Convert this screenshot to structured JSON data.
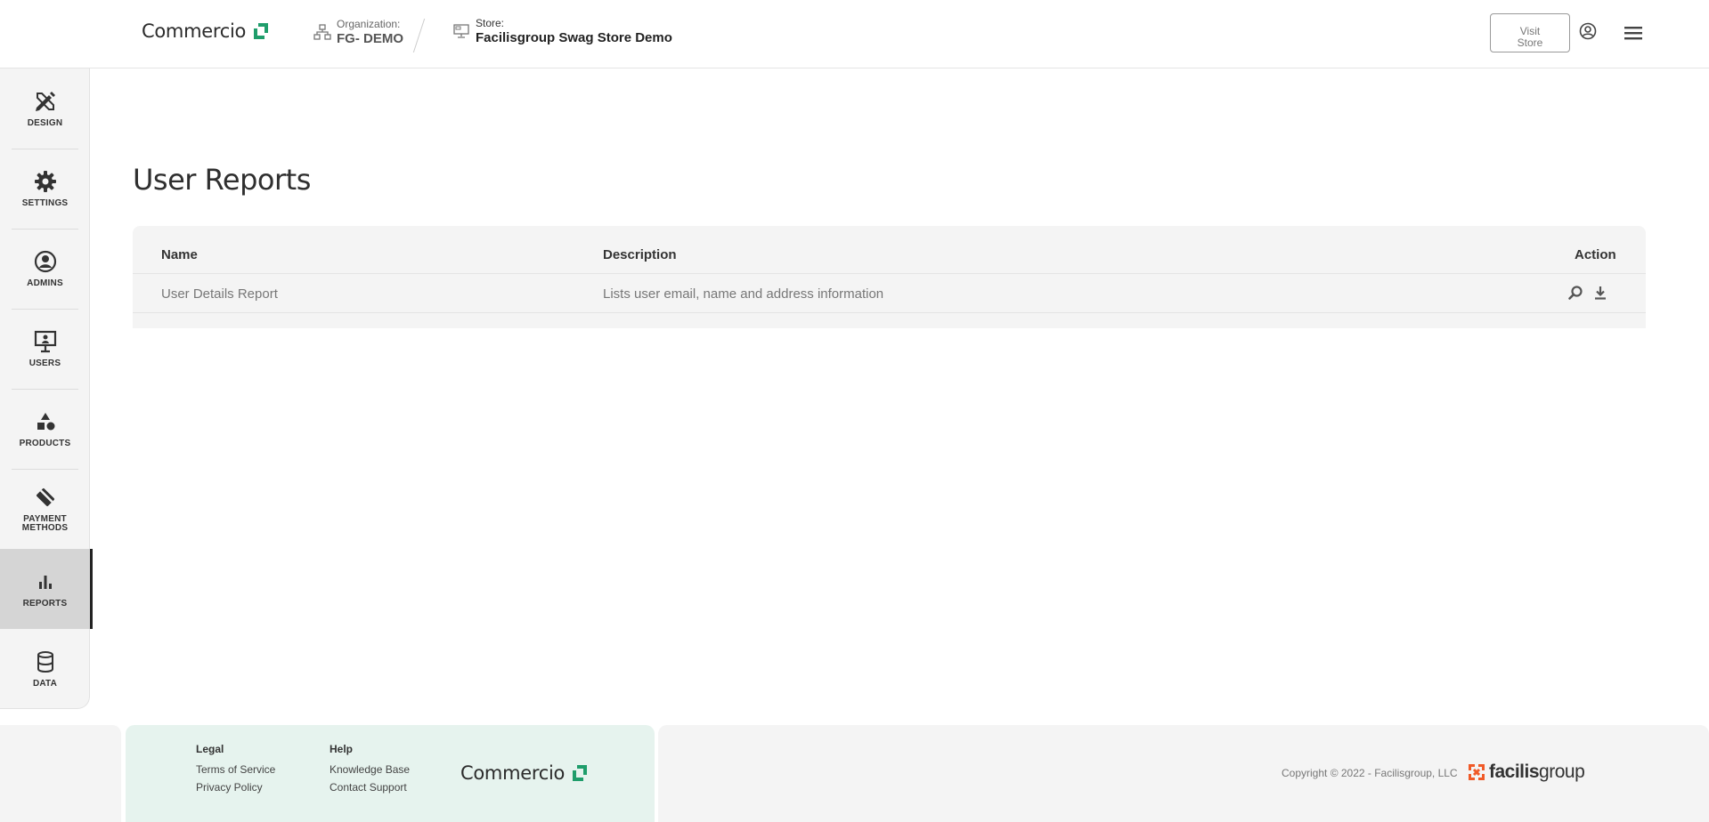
{
  "header": {
    "logo_text": "Commercio",
    "org_label": "Organization:",
    "org_value": "FG- DEMO",
    "store_label": "Store:",
    "store_value": "Facilisgroup Swag Store Demo",
    "visit_store_line1": "Visit",
    "visit_store_line2": "Store"
  },
  "sidebar": {
    "items": [
      {
        "label": "DESIGN",
        "icon": "design-pencil-ruler-icon"
      },
      {
        "label": "SETTINGS",
        "icon": "gear-icon"
      },
      {
        "label": "ADMINS",
        "icon": "user-circle-icon"
      },
      {
        "label": "USERS",
        "icon": "presentation-board-icon"
      },
      {
        "label": "PRODUCTS",
        "icon": "shapes-icon"
      },
      {
        "label_line1": "PAYMENT",
        "label_line2": "METHODS",
        "icon": "payment-card-icon"
      },
      {
        "label": "REPORTS",
        "icon": "bar-chart-icon",
        "active": true
      },
      {
        "label": "DATA",
        "icon": "database-icon"
      }
    ]
  },
  "main": {
    "title": "User Reports",
    "table": {
      "headers": {
        "name": "Name",
        "description": "Description",
        "action": "Action"
      },
      "rows": [
        {
          "name": "User Details Report",
          "description": "Lists user email, name and address information",
          "actions": [
            "search-icon",
            "download-icon"
          ]
        }
      ]
    }
  },
  "footer": {
    "legal_heading": "Legal",
    "terms": "Terms of Service",
    "privacy": "Privacy Policy",
    "help_heading": "Help",
    "knowledge_base": "Knowledge Base",
    "contact_support": "Contact Support",
    "logo_text": "Commercio",
    "copyright": "Copyright © 2022 - Facilisgroup, LLC",
    "brand_bold": "facilis",
    "brand_thin": "group"
  },
  "colors": {
    "brand_green": "#1f9d6b",
    "footer_mid_bg": "#e6f3ee",
    "facilis_orange": "#f05a28"
  }
}
